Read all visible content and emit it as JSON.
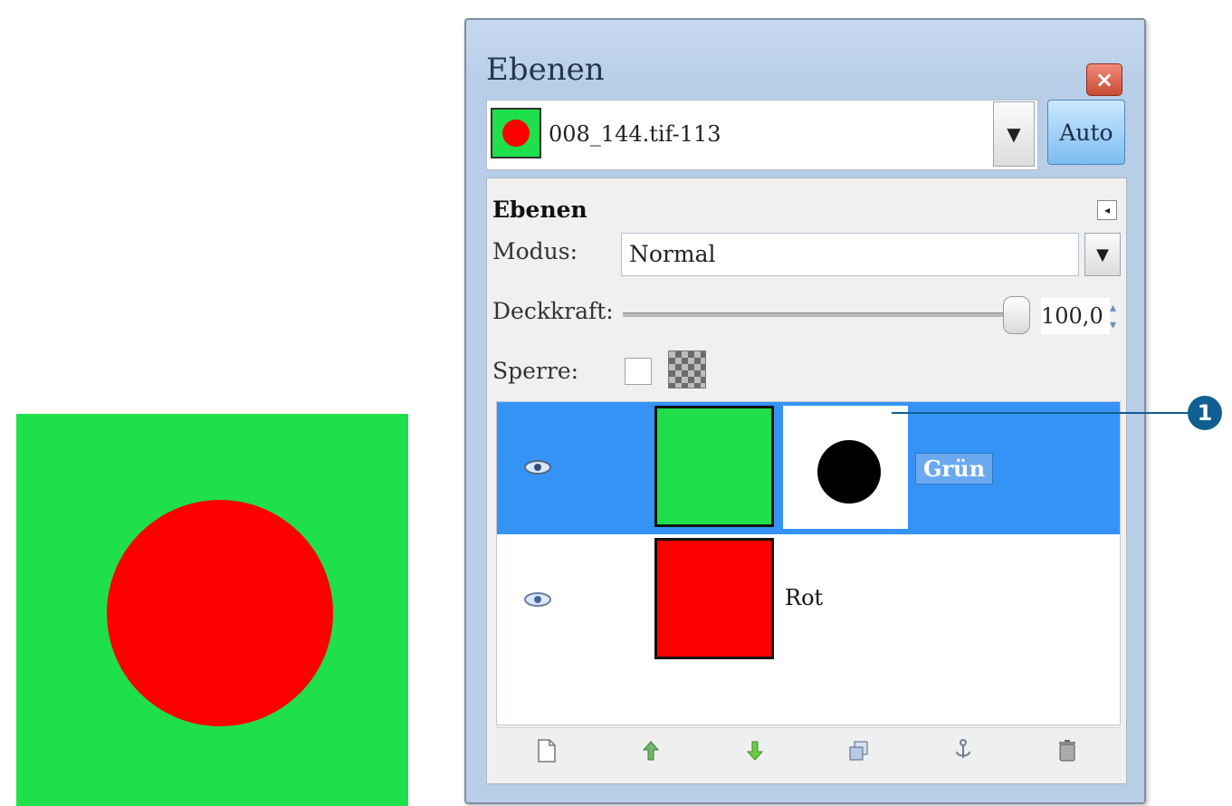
{
  "dock": {
    "title": "Ebenen",
    "close_symbol": "×"
  },
  "image_selector": {
    "name": "008_144.tif-113",
    "dropdown_symbol": "▼",
    "auto_label": "Auto"
  },
  "panel": {
    "heading": "Ebenen",
    "menu_symbol": "◂",
    "mode_label": "Modus:",
    "mode_value": "Normal",
    "mode_dropdown_symbol": "▼",
    "opacity_label": "Deckkraft:",
    "opacity_value": "100,0",
    "lock_label": "Sperre:"
  },
  "layers": [
    {
      "name": "Grün",
      "visible": true,
      "selected": true,
      "thumb_color": "#1fdf4a",
      "has_mask": true
    },
    {
      "name": "Rot",
      "visible": true,
      "selected": false,
      "thumb_color": "#ff0000",
      "has_mask": false
    }
  ],
  "toolbar": {
    "icons": [
      "new-layer-icon",
      "raise-layer-icon",
      "lower-layer-icon",
      "duplicate-layer-icon",
      "anchor-layer-icon",
      "delete-layer-icon"
    ]
  },
  "callout": {
    "number": "1"
  },
  "colors": {
    "canvas_background": "#1fdf4a",
    "canvas_circle": "#ff0000",
    "selection": "#3593f6"
  }
}
